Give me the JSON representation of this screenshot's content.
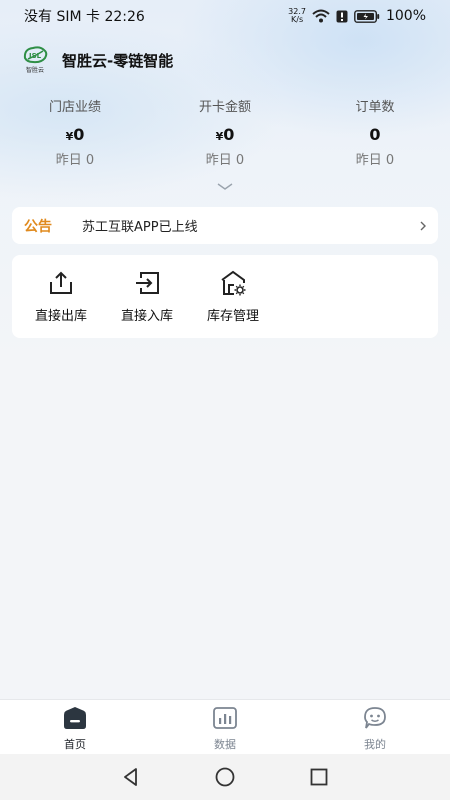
{
  "status_bar": {
    "left_text": "没有 SIM 卡 22:26",
    "net_speed_value": "32.7",
    "net_speed_unit": "K/s",
    "battery": "100%"
  },
  "header": {
    "logo_text": "智胜云",
    "title": "智胜云-零链智能"
  },
  "stats": [
    {
      "label": "门店业绩",
      "currency": "¥",
      "value": "0",
      "yesterday": "昨日 0"
    },
    {
      "label": "开卡金额",
      "currency": "¥",
      "value": "0",
      "yesterday": "昨日 0"
    },
    {
      "label": "订单数",
      "currency": "",
      "value": "0",
      "yesterday": "昨日 0"
    }
  ],
  "notice": {
    "tag": "公告",
    "text": "苏工互联APP已上线"
  },
  "actions": [
    {
      "label": "直接出库",
      "icon": "export-icon"
    },
    {
      "label": "直接入库",
      "icon": "import-icon"
    },
    {
      "label": "库存管理",
      "icon": "warehouse-settings-icon"
    }
  ],
  "tabbar": {
    "active": "首页",
    "tabs": [
      {
        "label": "首页",
        "icon": "home-icon"
      },
      {
        "label": "数据",
        "icon": "chart-icon"
      },
      {
        "label": "我的",
        "icon": "profile-icon"
      }
    ]
  },
  "colors": {
    "notice_tag": "#e08a1e",
    "tab_active": "#1f2329",
    "tab_inactive": "#7c8591"
  }
}
